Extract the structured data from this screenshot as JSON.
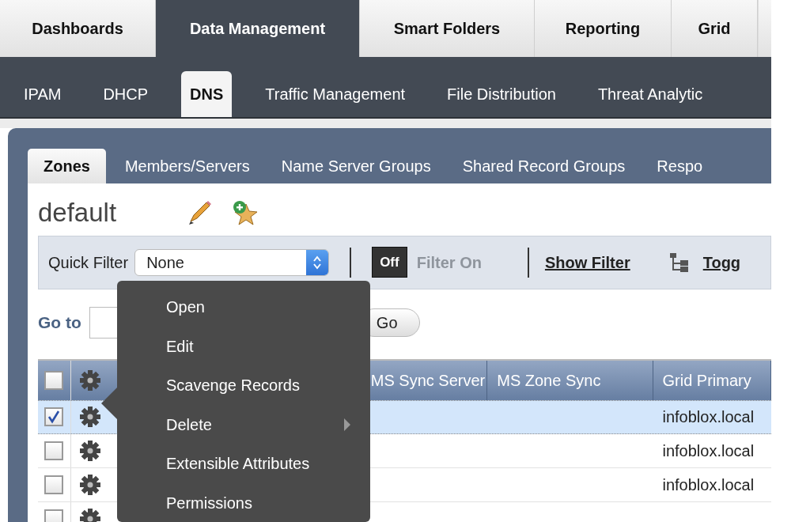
{
  "main_tabs": [
    {
      "label": "Dashboards",
      "selected": false
    },
    {
      "label": "Data Management",
      "selected": true
    },
    {
      "label": "Smart Folders",
      "selected": false
    },
    {
      "label": "Reporting",
      "selected": false
    },
    {
      "label": "Grid",
      "selected": false
    }
  ],
  "sub_tabs": [
    {
      "label": "IPAM",
      "selected": false
    },
    {
      "label": "DHCP",
      "selected": false
    },
    {
      "label": "DNS",
      "selected": true
    },
    {
      "label": "Traffic Management",
      "selected": false
    },
    {
      "label": "File Distribution",
      "selected": false
    },
    {
      "label": "Threat Analytic",
      "selected": false
    }
  ],
  "inner_tabs": [
    {
      "label": "Zones",
      "selected": true
    },
    {
      "label": "Members/Servers",
      "selected": false
    },
    {
      "label": "Name Server Groups",
      "selected": false
    },
    {
      "label": "Shared Record Groups",
      "selected": false
    },
    {
      "label": "Respo",
      "selected": false
    }
  ],
  "title": "default",
  "filter": {
    "label": "Quick Filter",
    "value": "None",
    "toggle": {
      "on": false,
      "off_label": "Off",
      "on_label": "Filter On"
    },
    "show_filter": "Show Filter",
    "toggle_link": "Togg"
  },
  "goto": {
    "label": "Go to",
    "button": "Go"
  },
  "table": {
    "all_checked": false,
    "columns": [
      {
        "label": "MS Sync Server"
      },
      {
        "label": "MS Zone Sync"
      },
      {
        "label": "Grid Primary"
      }
    ],
    "rows": [
      {
        "grid_primary": "infoblox.local",
        "checked": true,
        "selected": true
      },
      {
        "grid_primary": "infoblox.local",
        "checked": false,
        "selected": false
      },
      {
        "grid_primary": "infoblox.local",
        "checked": false,
        "selected": false
      },
      {
        "checked": false,
        "selected": false
      }
    ]
  },
  "context_menu": {
    "items": [
      {
        "label": "Open",
        "has_submenu": false
      },
      {
        "label": "Edit",
        "has_submenu": false
      },
      {
        "label": "Scavenge Records",
        "has_submenu": false
      },
      {
        "label": "Delete",
        "has_submenu": true
      },
      {
        "label": "Extensible Attributes",
        "has_submenu": false
      },
      {
        "label": "Permissions",
        "has_submenu": false
      }
    ]
  }
}
